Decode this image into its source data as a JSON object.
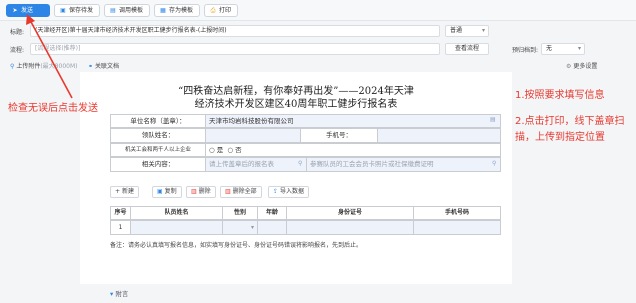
{
  "toolbar": {
    "send": "发送",
    "save_draft": "保存待发",
    "use_template": "调用模板",
    "save_template": "存为模板",
    "print": "打印"
  },
  "form": {
    "subject_label": "标题:",
    "subject_value": "(天津经开区)第十届天津市经济技术开发区职工健步行报名表-(上报时间)",
    "priority_value": "普通",
    "process_label": "流程:",
    "process_placeholder": "[流程选择(推荐)]",
    "view_process": "查看流程",
    "archive_label": "预归档到:",
    "archive_value": "无",
    "more_settings": "更多设置",
    "upload_attachment": "上传附件",
    "upload_hint": "(最大8000M)",
    "related_doc": "关联文档"
  },
  "document": {
    "title_line1": "“四秩奋达启新程，有你奉好再出发”——2024年天津",
    "title_line2": "经济技术开发区建区40周年职工健步行报名表",
    "unit_label": "单位名称（盖章）：",
    "unit_value": "天津市均岩科技股份有限公司",
    "leader_label": "领队姓名：",
    "phone_label": "手机号：",
    "labor_label": "机关工会和两千人以上企业",
    "option_yes": "是",
    "option_no": "否",
    "materials_label": "相关内容：",
    "materials_placeholder1": "请上传盖章后的报名表",
    "materials_placeholder2": "参赛队员的工会会员卡照片或社保缴费证明",
    "actions": {
      "add": "新建",
      "copy": "复制",
      "delete": "删除",
      "delete_all": "删除全部",
      "import": "导入数据"
    },
    "table": {
      "headers": [
        "序号",
        "队员姓名",
        "性别",
        "年龄",
        "身份证号",
        "手机号码"
      ],
      "rows": [
        [
          "1",
          "",
          "",
          "",
          "",
          ""
        ]
      ]
    },
    "note": "备注：请务必认真填写报名信息，如实填写身份证号、身份证号码错误将影响报名，先到后止。"
  },
  "annotations": {
    "left": "检查无误后点击发送",
    "right1": "1.按照要求填写信息",
    "right2_line1": "2.点击打印，线下盖章扫",
    "right2_line2": "描，上传到指定位置"
  },
  "footer": {
    "attachment": "附言"
  },
  "colors": {
    "accent": "#2d86e6",
    "annotation": "#e8392f"
  }
}
